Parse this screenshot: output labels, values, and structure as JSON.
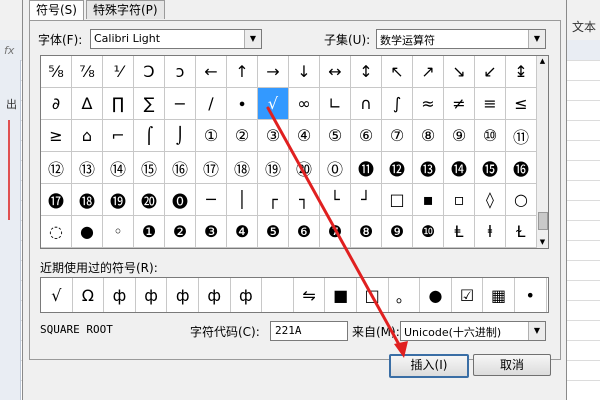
{
  "tabs": [
    "符号(S)",
    "特殊字符(P)"
  ],
  "font_label": "字体(F):",
  "font_value": "Calibri Light",
  "subset_label": "子集(U):",
  "subset_value": "数学运算符",
  "symbols": [
    "⅝",
    "⅞",
    "⅟",
    "Ↄ",
    "ↄ",
    "←",
    "↑",
    "→",
    "↓",
    "↔",
    "↕",
    "↖",
    "↗",
    "↘",
    "↙",
    "↨",
    "∂",
    "∆",
    "∏",
    "∑",
    "−",
    "∕",
    "∙",
    "√",
    "∞",
    "∟",
    "∩",
    "∫",
    "≈",
    "≠",
    "≡",
    "≤",
    "≥",
    "⌂",
    "⌐",
    "⌠",
    "⌡",
    "①",
    "②",
    "③",
    "④",
    "⑤",
    "⑥",
    "⑦",
    "⑧",
    "⑨",
    "⑩",
    "⑪",
    "⑫",
    "⑬",
    "⑭",
    "⑮",
    "⑯",
    "⑰",
    "⑱",
    "⑲",
    "⑳",
    "⓪",
    "⓫",
    "⓬",
    "⓭",
    "⓮",
    "⓯",
    "⓰",
    "⓱",
    "⓲",
    "⓳",
    "⓴",
    "⓿",
    "─",
    "│",
    "┌",
    "┐",
    "└",
    "┘",
    "□",
    "▪",
    "▫",
    "◊",
    "○",
    "◌",
    "●",
    "◦",
    "❶",
    "❷",
    "❸",
    "❹",
    "❺",
    "❻",
    "❼",
    "❽",
    "❾",
    "❿",
    "Ⱡ",
    "ⱡ",
    "Ɫ"
  ],
  "selected_index": 23,
  "recent_label": "近期使用过的符号(R):",
  "recent": [
    "√",
    "Ω",
    "ф",
    "ф",
    "ф",
    "ф",
    "ф",
    "",
    "⇋",
    "■",
    "□",
    "。",
    "●",
    "☑",
    "▦",
    "•"
  ],
  "char_name": "SQUARE ROOT",
  "code_label": "字符代码(C):",
  "code_value": "221A",
  "from_label": "来自(M):",
  "from_value": "Unicode(十六进制)",
  "insert_label": "插入(I)",
  "cancel_label": "取消",
  "bg": {
    "text_label": "文本",
    "fx": "fx",
    "left_char": "出"
  },
  "colors": {
    "selection": "#3399ff",
    "annotation_red": "#e02020",
    "default_button_border": "#3a6ea5"
  }
}
